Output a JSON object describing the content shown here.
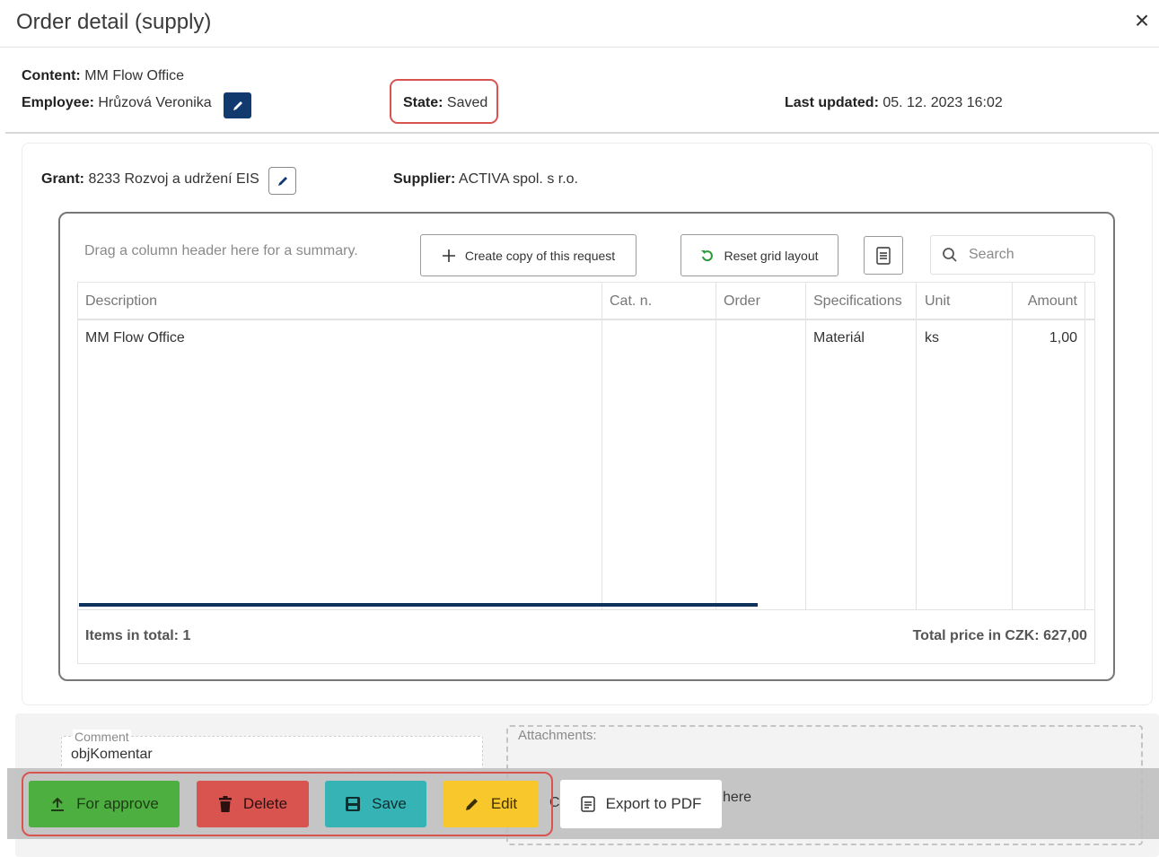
{
  "dialog": {
    "title": "Order detail (supply)",
    "close_icon": "×"
  },
  "info": {
    "content_label": "Content:",
    "content_value": "MM Flow Office",
    "employee_label": "Employee:",
    "employee_value": "Hrůzová Veronika",
    "state_label": "State:",
    "state_value": "Saved",
    "last_updated_label": "Last updated:",
    "last_updated_value": "05. 12. 2023 16:02",
    "grant_label": "Grant:",
    "grant_value": "8233 Rozvoj a udržení EIS",
    "supplier_label": "Supplier:",
    "supplier_value": "ACTIVA spol. s r.o."
  },
  "grid": {
    "drag_hint": "Drag a column header here for a summary.",
    "copy_button": "Create copy of this request",
    "reset_button": "Reset grid layout",
    "export_icon": "xlsx-export-icon",
    "search_placeholder": "Search",
    "columns": [
      "Description",
      "Cat. n.",
      "Order",
      "Specifications",
      "Unit",
      "Amount"
    ],
    "rows": [
      {
        "description": "MM Flow Office",
        "cat_n": "",
        "order": "",
        "specifications": "Materiál",
        "unit": "ks",
        "amount": "1,00"
      }
    ],
    "items_total": "Items in total: 1",
    "total_price": "Total price in CZK: 627,00"
  },
  "comment": {
    "label": "Comment",
    "value": "objKomentar"
  },
  "attachments": {
    "label": "Attachments:",
    "hint_tail": "here"
  },
  "actions": {
    "approve": "For approve",
    "delete": "Delete",
    "save": "Save",
    "edit": "Edit",
    "export_pdf": "Export to PDF"
  },
  "colors": {
    "approve": "#4caf3f",
    "delete": "#d9534f",
    "save": "#36b3b5",
    "edit": "#f7c72c",
    "highlight": "#d9534f",
    "primary_dark": "#113a6e"
  }
}
